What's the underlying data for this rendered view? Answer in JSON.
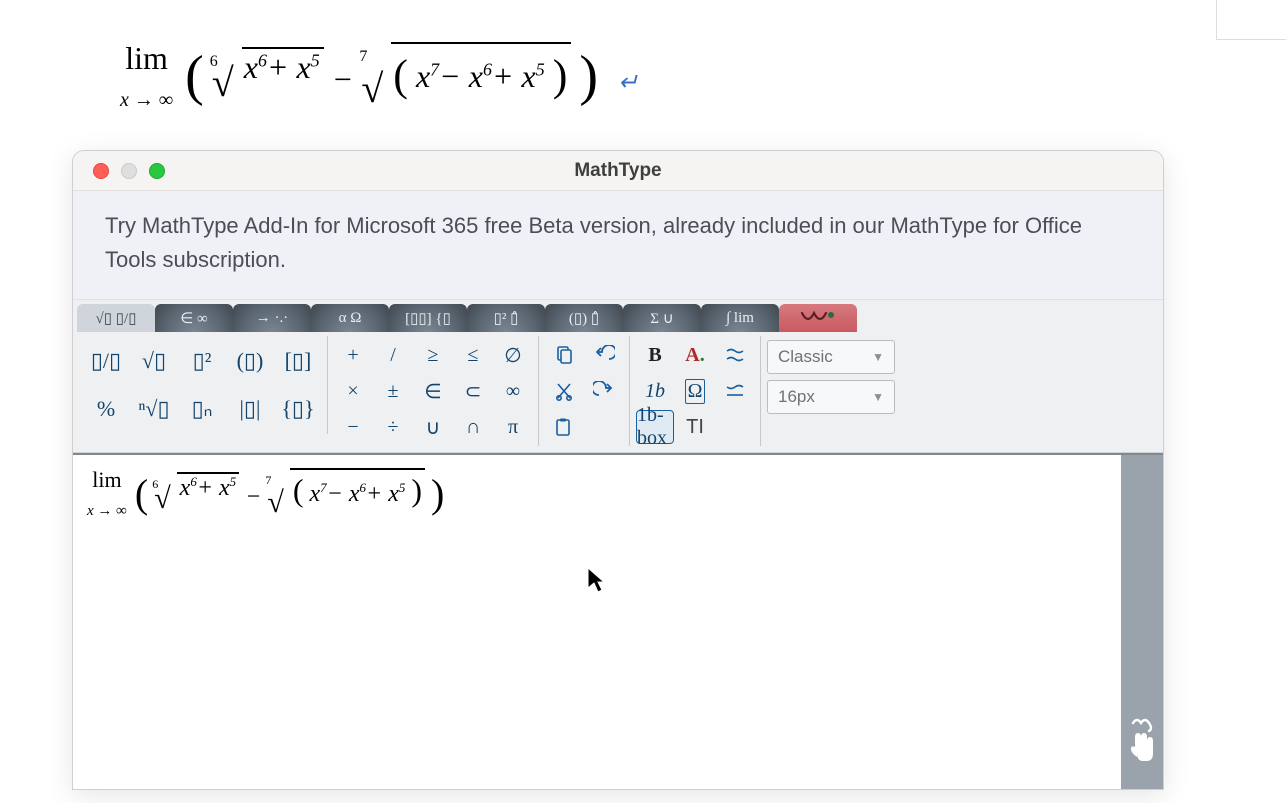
{
  "window": {
    "title": "MathType",
    "banner": "Try MathType Add-In for Microsoft 365 free Beta version, already included in our MathType for Office Tools subscription."
  },
  "toolbar": {
    "tabs": [
      "√▯ ▯/▯",
      "∈ ∞",
      "→ ·.·",
      "α Ω",
      "[▯▯] {▯",
      "▯² ▯̂",
      "(▯) ▯̂",
      "Σ ∪",
      "∫ lim",
      "wiris"
    ],
    "group1": [
      "▯/▯",
      "√▯",
      "▯²",
      "(▯)",
      "[▯]",
      "%",
      "ⁿ√▯",
      "▯ₙ",
      "|▯|",
      "{▯}"
    ],
    "group2": [
      "+",
      "/",
      "≥",
      "≤",
      "∅",
      "×",
      "±",
      "∈",
      "⊂",
      "∞",
      "−",
      "÷",
      "∪",
      "∩",
      "π"
    ],
    "group3": [
      "copy",
      "undo",
      "cut",
      "redo",
      "paste"
    ],
    "group4": [
      "B",
      "A",
      "rtl",
      "1b",
      "Ω",
      "ltr",
      "1b-box",
      "TI"
    ],
    "style_dd": "Classic",
    "size_dd": "16px"
  },
  "document_equation": {
    "lim": "lim",
    "lim_sub": "x → ∞",
    "root1_index": "6",
    "root1_content_parts": [
      "x",
      "6",
      "+ x",
      "5"
    ],
    "minus": " − ",
    "root2_index": "7",
    "root2_inner_parts": [
      "x",
      "7",
      "− x",
      "6",
      "+ x",
      "5"
    ]
  },
  "editor_equation": {
    "lim": "lim",
    "lim_sub": "x → ∞",
    "root1_index": "6",
    "root1_content_parts": [
      "x",
      "6",
      "+ x",
      "5"
    ],
    "minus": " − ",
    "root2_index": "7",
    "root2_inner_parts": [
      "x",
      "7",
      "− x",
      "6",
      "+ x",
      "5"
    ]
  }
}
